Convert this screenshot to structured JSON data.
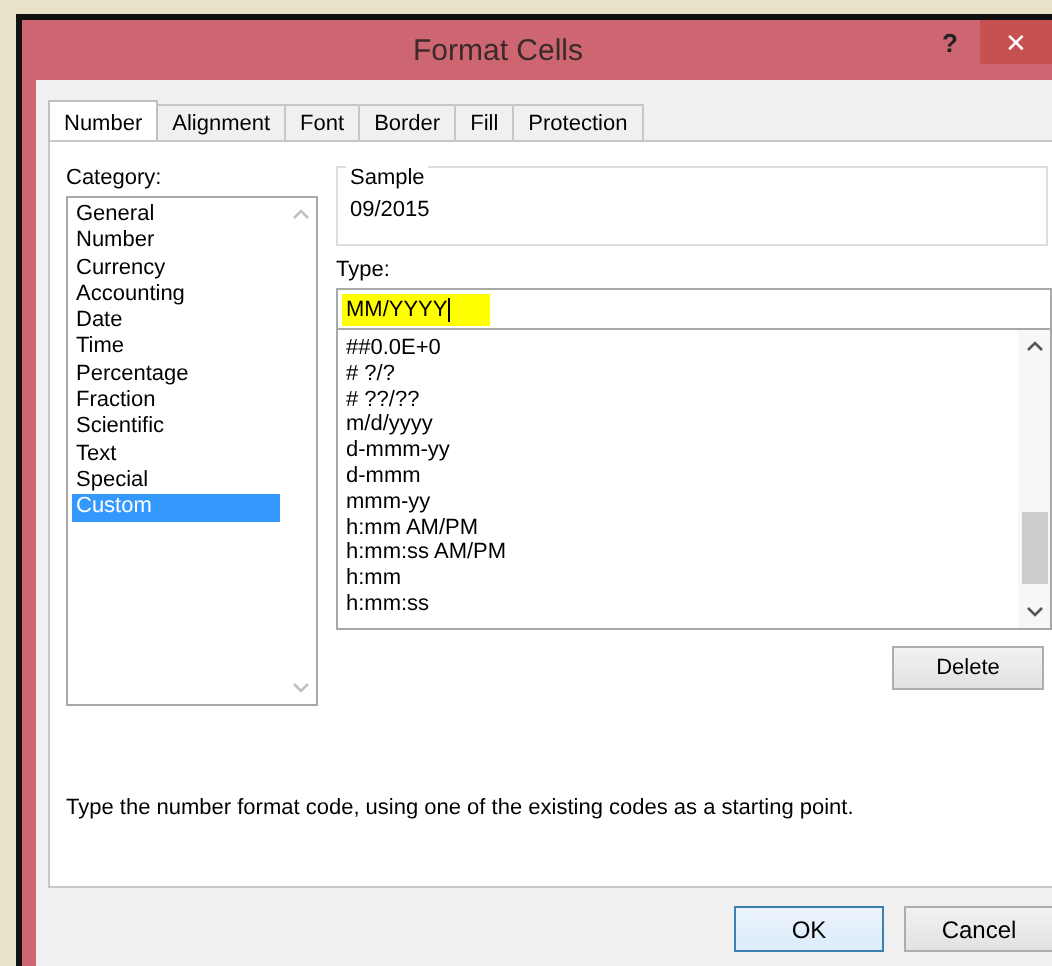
{
  "window": {
    "title": "Format Cells",
    "help": "?",
    "close": "✕"
  },
  "tabs": [
    {
      "label": "Number",
      "selected": true
    },
    {
      "label": "Alignment",
      "selected": false
    },
    {
      "label": "Font",
      "selected": false
    },
    {
      "label": "Border",
      "selected": false
    },
    {
      "label": "Fill",
      "selected": false
    },
    {
      "label": "Protection",
      "selected": false
    }
  ],
  "category": {
    "label": "Category:",
    "items": [
      {
        "label": "General",
        "selected": false
      },
      {
        "label": "Number",
        "selected": false
      },
      {
        "label": "Currency",
        "selected": false
      },
      {
        "label": "Accounting",
        "selected": false
      },
      {
        "label": "Date",
        "selected": false
      },
      {
        "label": "Time",
        "selected": false
      },
      {
        "label": "Percentage",
        "selected": false
      },
      {
        "label": "Fraction",
        "selected": false
      },
      {
        "label": "Scientific",
        "selected": false
      },
      {
        "label": "Text",
        "selected": false
      },
      {
        "label": "Special",
        "selected": false
      },
      {
        "label": "Custom",
        "selected": true
      }
    ]
  },
  "sample": {
    "label": "Sample",
    "value": "09/2015"
  },
  "type": {
    "label": "Type:",
    "value": "MM/YYYY",
    "highlighted": true,
    "items": [
      {
        "label": "##0.0E+0",
        "selected": false
      },
      {
        "label": "# ?/?",
        "selected": false
      },
      {
        "label": "# ??/??",
        "selected": false
      },
      {
        "label": "m/d/yyyy",
        "selected": false
      },
      {
        "label": "d-mmm-yy",
        "selected": false
      },
      {
        "label": "d-mmm",
        "selected": false
      },
      {
        "label": "mmm-yy",
        "selected": false
      },
      {
        "label": "h:mm AM/PM",
        "selected": false
      },
      {
        "label": "h:mm:ss AM/PM",
        "selected": false
      },
      {
        "label": "h:mm",
        "selected": false
      },
      {
        "label": "h:mm:ss",
        "selected": false
      }
    ]
  },
  "delete_button": "Delete",
  "description": "Type the number format code, using one of the existing codes as a starting point.",
  "buttons": [
    {
      "label": "OK",
      "kind": "default"
    },
    {
      "label": "Cancel",
      "kind": "normal"
    }
  ]
}
